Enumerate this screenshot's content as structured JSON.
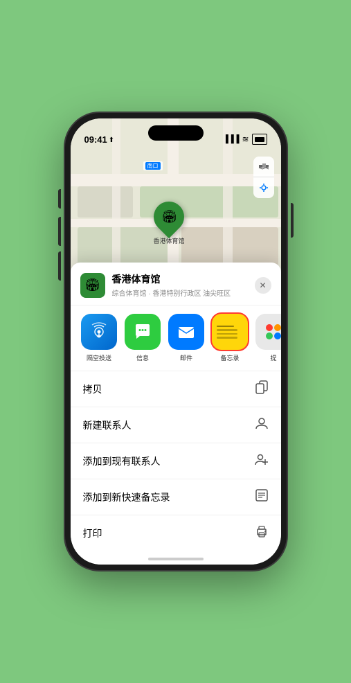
{
  "status_bar": {
    "time": "09:41",
    "location_arrow": "▶"
  },
  "map": {
    "label": "南口",
    "location_name": "香港体育馆",
    "pin_emoji": "🏟"
  },
  "location_header": {
    "name": "香港体育馆",
    "subtitle": "综合体育馆 · 香港特别行政区 油尖旺区"
  },
  "share_items": [
    {
      "id": "airdrop",
      "label": "隔空投送"
    },
    {
      "id": "messages",
      "label": "信息"
    },
    {
      "id": "mail",
      "label": "邮件"
    },
    {
      "id": "notes",
      "label": "备忘录"
    },
    {
      "id": "more",
      "label": "提"
    }
  ],
  "action_rows": [
    {
      "label": "拷贝",
      "icon": "copy"
    },
    {
      "label": "新建联系人",
      "icon": "person"
    },
    {
      "label": "添加到现有联系人",
      "icon": "person-add"
    },
    {
      "label": "添加到新快速备忘录",
      "icon": "note"
    },
    {
      "label": "打印",
      "icon": "print"
    }
  ],
  "colors": {
    "green": "#2e8b35",
    "highlight_red": "#ff3b30",
    "notes_yellow": "#ffd60a"
  }
}
